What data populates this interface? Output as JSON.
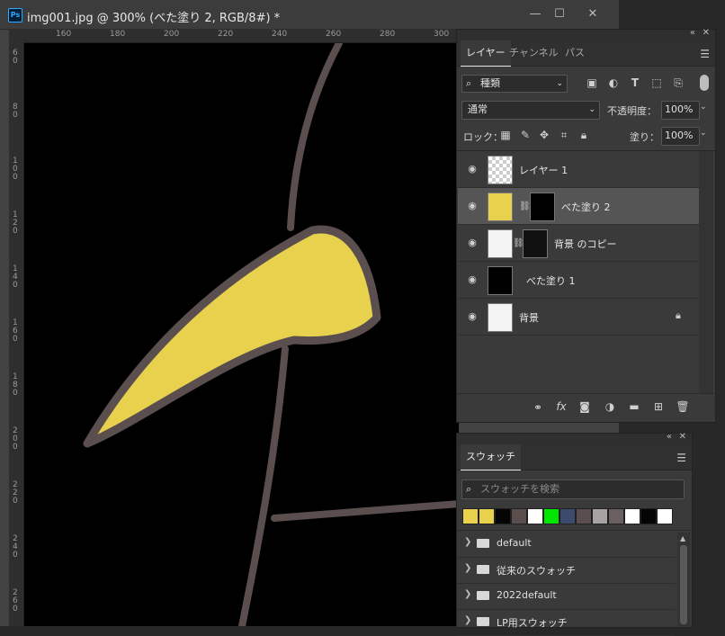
{
  "document": {
    "title": "img001.jpg @ 300% (べた塗り 2, RGB/8#) *",
    "app_icon": "Ps",
    "controls": {
      "minimize": "—",
      "maximize": "☐",
      "close": "✕"
    },
    "ruler_top": [
      "160",
      "180",
      "200",
      "220",
      "240",
      "260",
      "280",
      "300"
    ],
    "ruler_left": [
      "6\n0",
      "8\n0",
      "1\n0\n0",
      "1\n2\n0",
      "1\n4\n0",
      "1\n6\n0",
      "1\n8\n0",
      "2\n0\n0",
      "2\n2\n0",
      "2\n4\n0",
      "2\n6\n0"
    ],
    "colors": {
      "fill_yellow": "#e8d14d",
      "stroke": "#5a4e4e",
      "canvas": "#000000"
    }
  },
  "layers_panel": {
    "tabs": [
      "レイヤー",
      "チャンネル",
      "パス"
    ],
    "active_tab": 0,
    "filter": {
      "label": "種類"
    },
    "blend_mode": "通常",
    "opacity_label": "不透明度：",
    "opacity_value": "100%",
    "lock_label": "ロック：",
    "fill_label": "塗り：",
    "fill_value": "100%",
    "layers": [
      {
        "name": "レイヤー 1"
      },
      {
        "name": "べた塗り 2",
        "selected": true
      },
      {
        "name": "背景 のコピー"
      },
      {
        "name": "べた塗り 1"
      },
      {
        "name": "背景",
        "locked": true
      }
    ],
    "footer_icons": [
      "link-icon",
      "fx-icon",
      "mask-icon",
      "adjustment-icon",
      "folder-icon",
      "new-layer-icon",
      "trash-icon"
    ]
  },
  "swatches_panel": {
    "tab": "スウォッチ",
    "search_placeholder": "スウォッチを検索",
    "recent_colors": [
      "#e8d14d",
      "#e8d14d",
      "#050505",
      "#5a4e4e",
      "#ffffff",
      "#00e600",
      "#3c4a6e",
      "#5a4e4e",
      "#a8a2a2",
      "#6b6060",
      "#ffffff",
      "#050505",
      "#ffffff"
    ],
    "folders": [
      "default",
      "従来のスウォッチ",
      "2022default",
      "LP用スウォッチ"
    ]
  }
}
